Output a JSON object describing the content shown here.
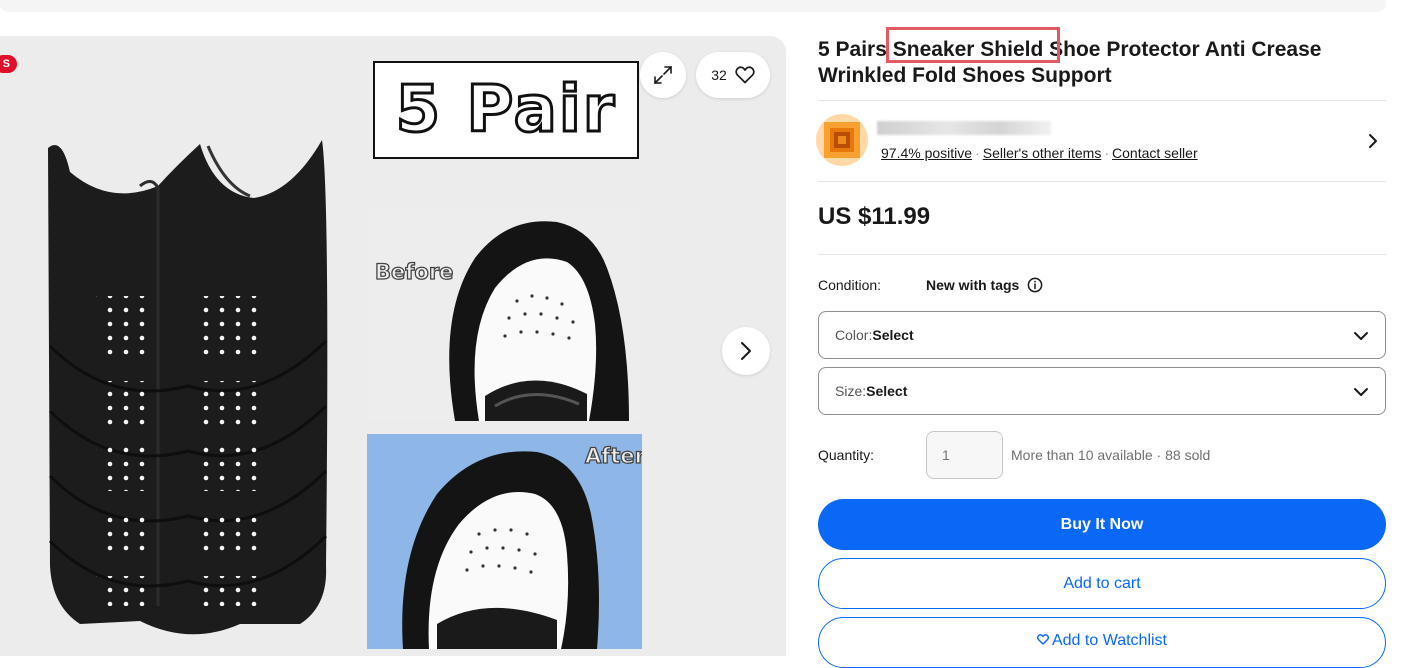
{
  "gallery": {
    "badge_text": "S",
    "watch_count": "32",
    "collage": {
      "headline": "5 Pair",
      "before_label": "Before",
      "after_label": "After"
    }
  },
  "listing": {
    "title_part1": "5 Pairs ",
    "title_highlight": "Sneaker Shield",
    "title_part2": " Shoe Protector Anti Crease Wrinkled Fold Shoes Support",
    "price": "US $11.99"
  },
  "seller": {
    "feedback": "97.4% positive",
    "other_items": "Seller's other items",
    "contact": "Contact seller",
    "separator": "·"
  },
  "condition": {
    "label": "Condition:",
    "value": "New with tags"
  },
  "selects": {
    "color": {
      "label": "Color: ",
      "value": "Select"
    },
    "size": {
      "label": "Size: ",
      "value": "Select"
    }
  },
  "quantity": {
    "label": "Quantity:",
    "placeholder": "1",
    "available": "More than 10 available",
    "sold": "88 sold",
    "separator": "·"
  },
  "actions": {
    "buy_now": "Buy It Now",
    "add_to_cart": "Add to cart",
    "add_to_watchlist": "Add to Watchlist"
  },
  "colors": {
    "accent": "#0968f6",
    "badge": "#e0102a",
    "highlight_box": "#e35a62"
  },
  "icons": [
    "expand-icon",
    "heart-icon",
    "chevron-right-icon",
    "info-icon",
    "chevron-down-icon"
  ]
}
